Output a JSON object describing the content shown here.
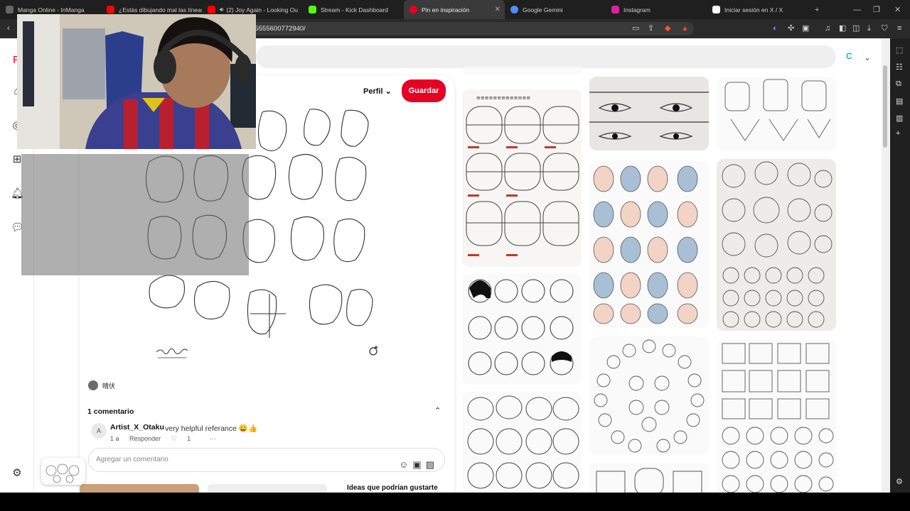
{
  "browser": {
    "tabs": [
      {
        "title": "Manga Online - InManga",
        "icon": "inmanga-icon",
        "color": "#666666"
      },
      {
        "title": "¿Estás dibujando mal las líneas",
        "icon": "youtube-icon",
        "color": "#ff0000"
      },
      {
        "title": "(2) Joy Again - Looking Ou",
        "icon": "youtube-icon",
        "color": "#ff0000"
      },
      {
        "title": "Stream - Kick Dashboard",
        "icon": "kick-icon",
        "color": "#53fc18"
      },
      {
        "title": "Pin en inspiración",
        "icon": "pinterest-icon",
        "color": "#e60023",
        "active": true
      },
      {
        "title": "Google Gemini",
        "icon": "gemini-icon",
        "color": "#4f8df5"
      },
      {
        "title": "Instagram",
        "icon": "instagram-icon",
        "color": "#d6249f"
      },
      {
        "title": "Iniciar sesión en X / X",
        "icon": "x-icon",
        "color": "#ffffff"
      }
    ],
    "url": "n/295555600772940/"
  },
  "pin": {
    "perfil_label": "Perfil",
    "save_label": "Guardar",
    "author_name": "晴伏",
    "comments_count_label": "1 comentario",
    "comment": {
      "avatar_letter": "A",
      "user": "Artist_X_Otaku",
      "text": "very helpful referance 😀👍",
      "time": "1 a",
      "reply_label": "Responder",
      "likes": "1",
      "more": "···"
    },
    "comment_placeholder": "Agregar un comentario",
    "related_label": "Ideas que podrían gustarte"
  },
  "colors": {
    "pinterest_red": "#e60023",
    "tab_bar": "#1f1f1f",
    "toolbar": "#2a2a2a"
  }
}
